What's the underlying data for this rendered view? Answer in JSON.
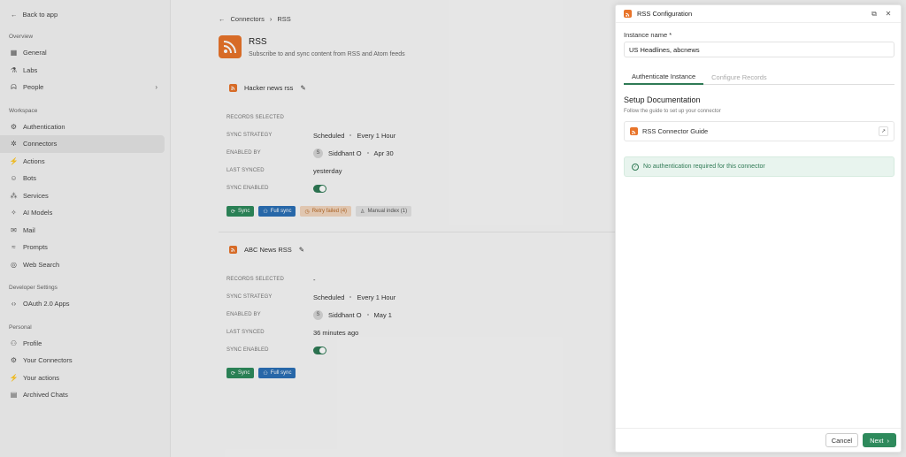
{
  "sidebar": {
    "back_label": "Back to app",
    "sections": [
      {
        "title": "Overview",
        "items": [
          {
            "label": "General",
            "icon": "grid-icon"
          },
          {
            "label": "Labs",
            "icon": "flask-icon"
          },
          {
            "label": "People",
            "icon": "people-icon",
            "expandable": true
          }
        ]
      },
      {
        "title": "Workspace",
        "items": [
          {
            "label": "Authentication",
            "icon": "key-icon"
          },
          {
            "label": "Connectors",
            "icon": "plug-icon",
            "active": true
          },
          {
            "label": "Actions",
            "icon": "bolt-icon"
          },
          {
            "label": "Bots",
            "icon": "bot-icon"
          },
          {
            "label": "Services",
            "icon": "services-icon"
          },
          {
            "label": "AI Models",
            "icon": "sparkle-icon"
          },
          {
            "label": "Mail",
            "icon": "mail-icon"
          },
          {
            "label": "Prompts",
            "icon": "prompt-icon"
          },
          {
            "label": "Web Search",
            "icon": "globe-icon"
          }
        ]
      },
      {
        "title": "Developer Settings",
        "items": [
          {
            "label": "OAuth 2.0 Apps",
            "icon": "code-icon"
          }
        ]
      },
      {
        "title": "Personal",
        "items": [
          {
            "label": "Profile",
            "icon": "user-icon"
          },
          {
            "label": "Your Connectors",
            "icon": "settings-icon"
          },
          {
            "label": "Your actions",
            "icon": "bolt-icon"
          },
          {
            "label": "Archived Chats",
            "icon": "archive-icon"
          }
        ]
      }
    ]
  },
  "main": {
    "breadcrumb": {
      "parent": "Connectors",
      "current": "RSS"
    },
    "title": "RSS",
    "subtitle": "Subscribe to and sync content from RSS and Atom feeds",
    "instances": [
      {
        "name": "Hacker news rss",
        "records_selected_label": "RECORDS SELECTED",
        "records_selected": "",
        "sync_strategy_label": "SYNC STRATEGY",
        "sync_strategy": "Scheduled",
        "sync_frequency": "Every 1 Hour",
        "enabled_by_label": "ENABLED BY",
        "enabled_by_initial": "S",
        "enabled_by": "Siddhant O",
        "enabled_date": "Apr 30",
        "last_synced_label": "LAST SYNCED",
        "last_synced": "yesterday",
        "sync_enabled_label": "SYNC ENABLED",
        "buttons": {
          "sync": "Sync",
          "full_sync": "Full sync",
          "retry": "Retry failed (4)",
          "manual": "Manual index (1)"
        }
      },
      {
        "name": "ABC News RSS",
        "records_selected_label": "RECORDS SELECTED",
        "records_selected": "-",
        "sync_strategy_label": "SYNC STRATEGY",
        "sync_strategy": "Scheduled",
        "sync_frequency": "Every 1 Hour",
        "enabled_by_label": "ENABLED BY",
        "enabled_by_initial": "S",
        "enabled_by": "Siddhant O",
        "enabled_date": "May 1",
        "last_synced_label": "LAST SYNCED",
        "last_synced": "36 minutes ago",
        "sync_enabled_label": "SYNC ENABLED",
        "buttons": {
          "sync": "Sync",
          "full_sync": "Full sync"
        }
      }
    ]
  },
  "drawer": {
    "title": "RSS Configuration",
    "instance_label": "Instance name *",
    "instance_value": "US Headlines, abcnews",
    "tabs": [
      {
        "label": "Authenticate Instance",
        "active": true
      },
      {
        "label": "Configure Records",
        "active": false
      }
    ],
    "doc_title": "Setup Documentation",
    "doc_subtitle": "Follow the guide to set up your connector",
    "guide_label": "RSS Connector Guide",
    "notice": "No authentication required for this connector",
    "cancel_label": "Cancel",
    "next_label": "Next"
  },
  "colors": {
    "accent": "#2e8a5c",
    "rss": "#e8742a",
    "blue": "#2a6fb5"
  }
}
